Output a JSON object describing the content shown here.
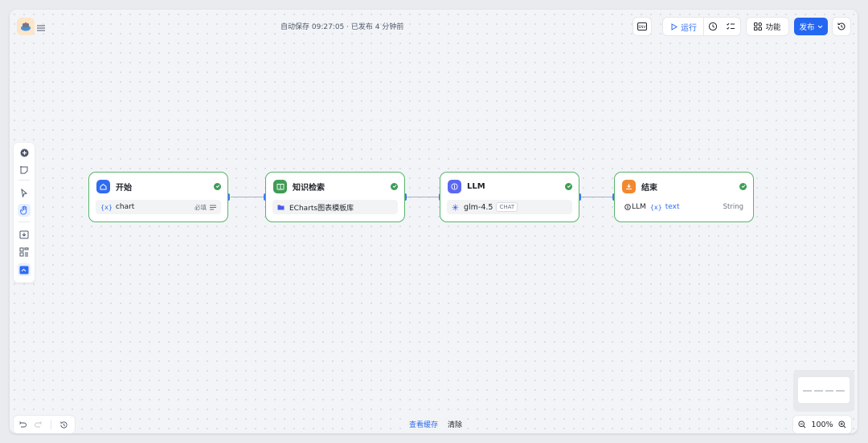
{
  "header": {
    "autosave_status": "自动保存 09:27:05 · 已发布 4 分钟前",
    "run_label": "运行",
    "feature_label": "功能",
    "publish_label": "发布",
    "icons": [
      "app-logo-icon",
      "menu-icon",
      "env-icon",
      "play-icon",
      "check-clock-icon",
      "checklist-icon",
      "apps-icon",
      "chevron-down-icon",
      "history-icon"
    ]
  },
  "left_toolbar": {
    "icons": [
      "add-node-icon",
      "add-note-icon",
      "pointer-icon",
      "hand-icon",
      "export-image-icon",
      "organize-icon",
      "minimap-toggle-icon"
    ]
  },
  "nodes": [
    {
      "title": "开始",
      "var_symbol": "{x}",
      "var_name": "chart",
      "required_label": "必填",
      "icon": "home-icon",
      "color": "#2f6bf2"
    },
    {
      "title": "知识检索",
      "dataset": "ECharts图表模板库",
      "icon": "book-icon",
      "color": "#3f9c55"
    },
    {
      "title": "LLM",
      "model": "glm-4.5",
      "mode": "CHAT",
      "icon": "llm-icon",
      "color": "#5b67f2"
    },
    {
      "title": "结束",
      "source": "LLM",
      "var_symbol": "{x}",
      "var_name": "text",
      "type": "String",
      "icon": "end-icon",
      "color": "#f2882f"
    }
  ],
  "footer": {
    "view_cache": "查看缓存",
    "clear": "清除",
    "zoom": "100%"
  },
  "colors": {
    "accent": "#2468f2",
    "node_border": "#57b56b",
    "success": "#3f9c55"
  }
}
